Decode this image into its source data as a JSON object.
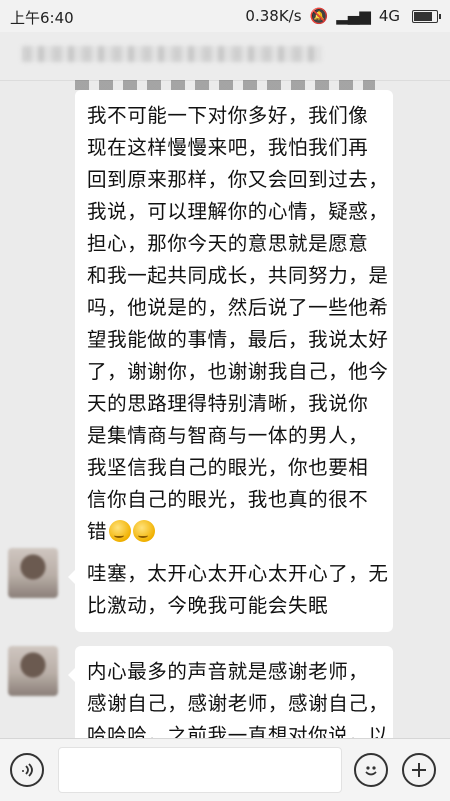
{
  "status_bar": {
    "time": "上午6:40",
    "network_speed": "0.38K/s",
    "network_type": "4G"
  },
  "chat": {
    "messages": [
      {
        "lines": [
          "我不可能一下对你多好，我们像",
          "现在这样慢慢来吧，我怕我们再",
          "回到原来那样，你又会回到过去，",
          "我说，可以理解你的心情，疑惑，",
          "担心，那你今天的意思就是愿意",
          "和我一起共同成长，共同努力，是",
          "吗，他说是的，然后说了一些他希",
          "望我能做的事情，最后，我说太好",
          "了，谢谢你，也谢谢我自己，他今",
          "天的思路理得特别清晰，我说你",
          "是集情商与智商与一体的男人，",
          "我坚信我自己的眼光，你也要相",
          "信你自己的眼光，我也真的很不",
          "错"
        ],
        "emoji_icons": [
          "thinking-emoji",
          "thinking-emoji"
        ]
      },
      {
        "lines": [
          "哇塞，太开心太开心太开心了，无",
          "比激动，今晚我可能会失眠"
        ]
      },
      {
        "lines": [
          "内心最多的声音就是感谢老师，",
          "感谢自己，感谢老师，感谢自己，",
          "哈哈哈，之前我一直想对你说，以"
        ]
      }
    ]
  },
  "input_bar": {
    "left_icon": "voice-icon",
    "right_icons": [
      "emoji-icon",
      "add-icon"
    ]
  }
}
